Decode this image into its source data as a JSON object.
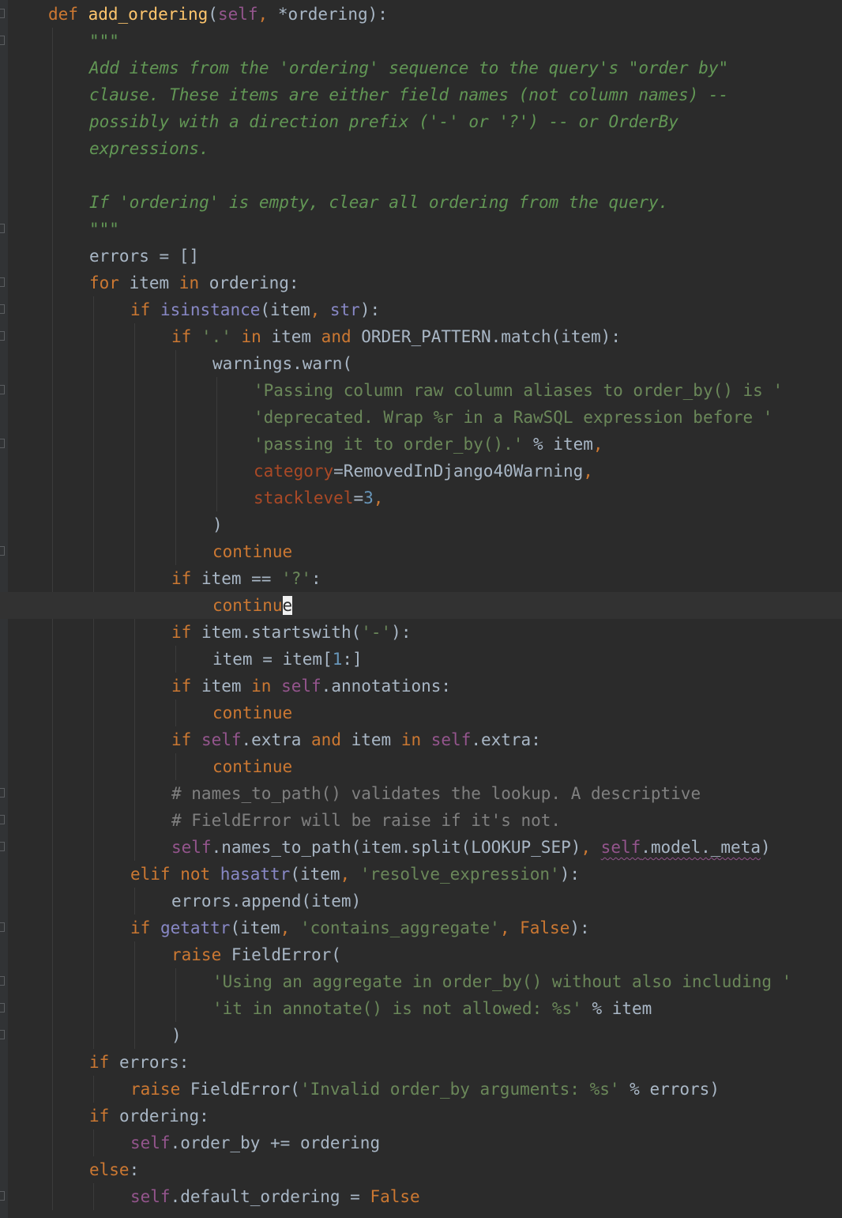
{
  "editor": {
    "language": "python",
    "current_line": 22,
    "caret_char": "e",
    "colors": {
      "background": "#2b2b2b",
      "current_line": "#323232",
      "keyword": "#cc7832",
      "function_name": "#ffc66d",
      "self": "#94558d",
      "builtin": "#8888c6",
      "string": "#6a8759",
      "docstring": "#629755",
      "comment": "#808080",
      "number": "#6897bb",
      "keyword_argument": "#aa4926",
      "identifier": "#a9b7c6"
    },
    "lines": [
      {
        "indent": 1,
        "fold": true,
        "tokens": [
          [
            "kw",
            "def "
          ],
          [
            "fn",
            "add_ordering"
          ],
          [
            "id",
            "("
          ],
          [
            "slf",
            "self"
          ],
          [
            "kw",
            ", "
          ],
          [
            "id",
            "*ordering):"
          ]
        ]
      },
      {
        "indent": 2,
        "fold": true,
        "tokens": [
          [
            "doc",
            "\"\"\""
          ]
        ]
      },
      {
        "indent": 2,
        "fold": false,
        "tokens": [
          [
            "doc",
            "Add items from the 'ordering' sequence to the query's \"order by\""
          ]
        ]
      },
      {
        "indent": 2,
        "fold": false,
        "tokens": [
          [
            "doc",
            "clause. These items are either field names (not column names) --"
          ]
        ]
      },
      {
        "indent": 2,
        "fold": false,
        "tokens": [
          [
            "doc",
            "possibly with a direction prefix ('-' or '?') -- or OrderBy"
          ]
        ]
      },
      {
        "indent": 2,
        "fold": false,
        "tokens": [
          [
            "doc",
            "expressions."
          ]
        ]
      },
      {
        "indent": 0,
        "fold": false,
        "tokens": []
      },
      {
        "indent": 2,
        "fold": false,
        "tokens": [
          [
            "doc",
            "If 'ordering' is empty, clear all ordering from the query."
          ]
        ]
      },
      {
        "indent": 2,
        "fold": true,
        "tokens": [
          [
            "doc",
            "\"\"\""
          ]
        ]
      },
      {
        "indent": 2,
        "fold": false,
        "tokens": [
          [
            "id",
            "errors = []"
          ]
        ]
      },
      {
        "indent": 2,
        "fold": true,
        "tokens": [
          [
            "kw",
            "for "
          ],
          [
            "id",
            "item "
          ],
          [
            "kw",
            "in "
          ],
          [
            "id",
            "ordering:"
          ]
        ]
      },
      {
        "indent": 3,
        "fold": true,
        "tokens": [
          [
            "kw",
            "if "
          ],
          [
            "bi",
            "isinstance"
          ],
          [
            "id",
            "(item"
          ],
          [
            "kw",
            ", "
          ],
          [
            "bi",
            "str"
          ],
          [
            "id",
            "):"
          ]
        ]
      },
      {
        "indent": 4,
        "fold": true,
        "tokens": [
          [
            "kw",
            "if "
          ],
          [
            "str",
            "'.' "
          ],
          [
            "kw",
            "in "
          ],
          [
            "id",
            "item "
          ],
          [
            "kw",
            "and "
          ],
          [
            "id",
            "ORDER_PATTERN.match(item):"
          ]
        ]
      },
      {
        "indent": 5,
        "fold": false,
        "tokens": [
          [
            "id",
            "warnings.warn("
          ]
        ]
      },
      {
        "indent": 6,
        "fold": true,
        "tokens": [
          [
            "str",
            "'Passing column raw column aliases to order_by() is '"
          ]
        ]
      },
      {
        "indent": 6,
        "fold": false,
        "tokens": [
          [
            "str",
            "'deprecated. Wrap %r in a RawSQL expression before '"
          ]
        ]
      },
      {
        "indent": 6,
        "fold": true,
        "tokens": [
          [
            "str",
            "'passing it to order_by().' "
          ],
          [
            "id",
            "% item"
          ],
          [
            "kw",
            ","
          ]
        ]
      },
      {
        "indent": 6,
        "fold": false,
        "tokens": [
          [
            "kwarg",
            "category"
          ],
          [
            "id",
            "=RemovedInDjango40Warning"
          ],
          [
            "kw",
            ","
          ]
        ]
      },
      {
        "indent": 6,
        "fold": false,
        "tokens": [
          [
            "kwarg",
            "stacklevel"
          ],
          [
            "id",
            "="
          ],
          [
            "num",
            "3"
          ],
          [
            "kw",
            ","
          ]
        ]
      },
      {
        "indent": 5,
        "fold": false,
        "tokens": [
          [
            "id",
            ")"
          ]
        ]
      },
      {
        "indent": 5,
        "fold": true,
        "tokens": [
          [
            "kw",
            "continue"
          ]
        ]
      },
      {
        "indent": 4,
        "fold": false,
        "tokens": [
          [
            "kw",
            "if "
          ],
          [
            "id",
            "item == "
          ],
          [
            "str",
            "'?'"
          ],
          [
            "id",
            ":"
          ]
        ]
      },
      {
        "indent": 5,
        "fold": false,
        "tokens": [
          [
            "kw",
            "continu"
          ],
          [
            "caret",
            "e"
          ]
        ]
      },
      {
        "indent": 4,
        "fold": false,
        "tokens": [
          [
            "kw",
            "if "
          ],
          [
            "id",
            "item.startswith("
          ],
          [
            "str",
            "'-'"
          ],
          [
            "id",
            "):"
          ]
        ]
      },
      {
        "indent": 5,
        "fold": false,
        "tokens": [
          [
            "id",
            "item = item["
          ],
          [
            "num",
            "1"
          ],
          [
            "id",
            ":]"
          ]
        ]
      },
      {
        "indent": 4,
        "fold": false,
        "tokens": [
          [
            "kw",
            "if "
          ],
          [
            "id",
            "item "
          ],
          [
            "kw",
            "in "
          ],
          [
            "slf",
            "self"
          ],
          [
            "id",
            ".annotations:"
          ]
        ]
      },
      {
        "indent": 5,
        "fold": false,
        "tokens": [
          [
            "kw",
            "continue"
          ]
        ]
      },
      {
        "indent": 4,
        "fold": false,
        "tokens": [
          [
            "kw",
            "if "
          ],
          [
            "slf",
            "self"
          ],
          [
            "id",
            ".extra "
          ],
          [
            "kw",
            "and "
          ],
          [
            "id",
            "item "
          ],
          [
            "kw",
            "in "
          ],
          [
            "slf",
            "self"
          ],
          [
            "id",
            ".extra:"
          ]
        ]
      },
      {
        "indent": 5,
        "fold": false,
        "tokens": [
          [
            "kw",
            "continue"
          ]
        ]
      },
      {
        "indent": 4,
        "fold": true,
        "tokens": [
          [
            "cmt",
            "# names_to_path() validates the lookup. A descriptive"
          ]
        ]
      },
      {
        "indent": 4,
        "fold": true,
        "tokens": [
          [
            "cmt",
            "# FieldError will be raise if it's not."
          ]
        ]
      },
      {
        "indent": 4,
        "fold": true,
        "tokens": [
          [
            "slf",
            "self"
          ],
          [
            "id",
            ".names_to_path(item.split(LOOKUP_SEP)"
          ],
          [
            "kw",
            ", "
          ],
          [
            "squig_self",
            "self"
          ],
          [
            "squig",
            ".model._meta"
          ],
          [
            "id",
            ")"
          ]
        ]
      },
      {
        "indent": 3,
        "fold": false,
        "tokens": [
          [
            "kw",
            "elif not "
          ],
          [
            "bi",
            "hasattr"
          ],
          [
            "id",
            "(item"
          ],
          [
            "kw",
            ", "
          ],
          [
            "str",
            "'resolve_expression'"
          ],
          [
            "id",
            "):"
          ]
        ]
      },
      {
        "indent": 4,
        "fold": false,
        "tokens": [
          [
            "id",
            "errors.append(item)"
          ]
        ]
      },
      {
        "indent": 3,
        "fold": true,
        "tokens": [
          [
            "kw",
            "if "
          ],
          [
            "bi",
            "getattr"
          ],
          [
            "id",
            "(item"
          ],
          [
            "kw",
            ", "
          ],
          [
            "str",
            "'contains_aggregate'"
          ],
          [
            "kw",
            ", False"
          ],
          [
            "id",
            "):"
          ]
        ]
      },
      {
        "indent": 4,
        "fold": false,
        "tokens": [
          [
            "kw",
            "raise "
          ],
          [
            "id",
            "FieldError("
          ]
        ]
      },
      {
        "indent": 5,
        "fold": true,
        "tokens": [
          [
            "str",
            "'Using an aggregate in order_by() without also including '"
          ]
        ]
      },
      {
        "indent": 5,
        "fold": true,
        "tokens": [
          [
            "str",
            "'it in annotate() is not allowed: %s' "
          ],
          [
            "id",
            "% item"
          ]
        ]
      },
      {
        "indent": 4,
        "fold": true,
        "tokens": [
          [
            "id",
            ")"
          ]
        ]
      },
      {
        "indent": 2,
        "fold": false,
        "tokens": [
          [
            "kw",
            "if "
          ],
          [
            "id",
            "errors:"
          ]
        ]
      },
      {
        "indent": 3,
        "fold": false,
        "tokens": [
          [
            "kw",
            "raise "
          ],
          [
            "id",
            "FieldError("
          ],
          [
            "str",
            "'Invalid order_by arguments: %s' "
          ],
          [
            "id",
            "% errors)"
          ]
        ]
      },
      {
        "indent": 2,
        "fold": false,
        "tokens": [
          [
            "kw",
            "if "
          ],
          [
            "id",
            "ordering:"
          ]
        ]
      },
      {
        "indent": 3,
        "fold": false,
        "tokens": [
          [
            "slf",
            "self"
          ],
          [
            "id",
            ".order_by += ordering"
          ]
        ]
      },
      {
        "indent": 2,
        "fold": false,
        "tokens": [
          [
            "kw",
            "else"
          ],
          [
            "id",
            ":"
          ]
        ]
      },
      {
        "indent": 3,
        "fold": true,
        "tokens": [
          [
            "slf",
            "self"
          ],
          [
            "id",
            ".default_ordering = "
          ],
          [
            "kw",
            "False"
          ]
        ]
      }
    ]
  }
}
